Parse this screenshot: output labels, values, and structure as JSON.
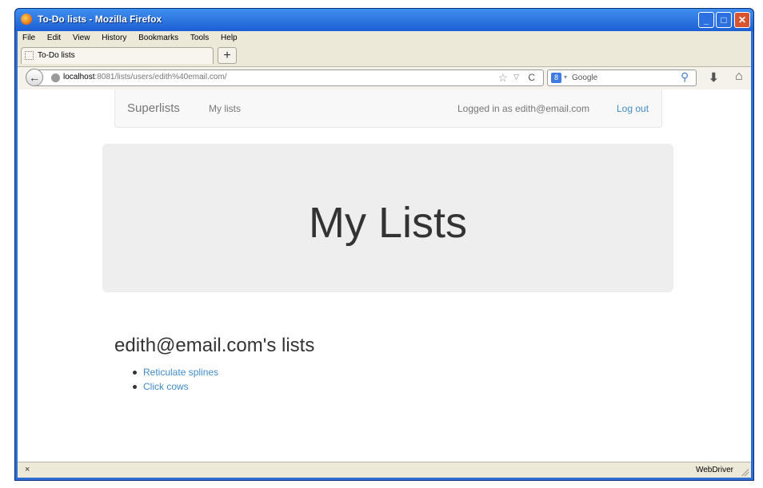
{
  "window": {
    "title": "To-Do lists - Mozilla Firefox",
    "buttons": {
      "minimize": "_",
      "maximize": "□",
      "close": "✕"
    }
  },
  "menu": [
    "File",
    "Edit",
    "View",
    "History",
    "Bookmarks",
    "Tools",
    "Help"
  ],
  "tab": {
    "label": "To-Do lists",
    "new_tab_label": "+"
  },
  "navbar": {
    "back_icon": "←",
    "url_host": "localhost",
    "url_rest": ":8081/lists/users/edith%40email.com/",
    "search_placeholder": "Google",
    "search_engine_icon": "8"
  },
  "site_nav": {
    "brand": "Superlists",
    "my_lists_link": "My lists",
    "logged_in_text": "Logged in as edith@email.com",
    "logout_link": "Log out"
  },
  "jumbotron": {
    "title": "My Lists"
  },
  "lists_section": {
    "heading": "edith@email.com's lists",
    "items": [
      "Reticulate splines",
      "Click cows"
    ]
  },
  "statusbar": {
    "close_icon": "×",
    "text": "WebDriver"
  },
  "colors": {
    "link": "#428bca",
    "jumbotron_bg": "#eeeeee",
    "window_frame": "#2f6fd1"
  },
  "icons": [
    "firefox-icon",
    "back-arrow-icon",
    "globe-icon",
    "bookmark-star-icon",
    "reload-icon",
    "google-icon",
    "search-magnifier-icon",
    "download-icon",
    "home-icon",
    "close-icon",
    "resize-grip-icon"
  ]
}
